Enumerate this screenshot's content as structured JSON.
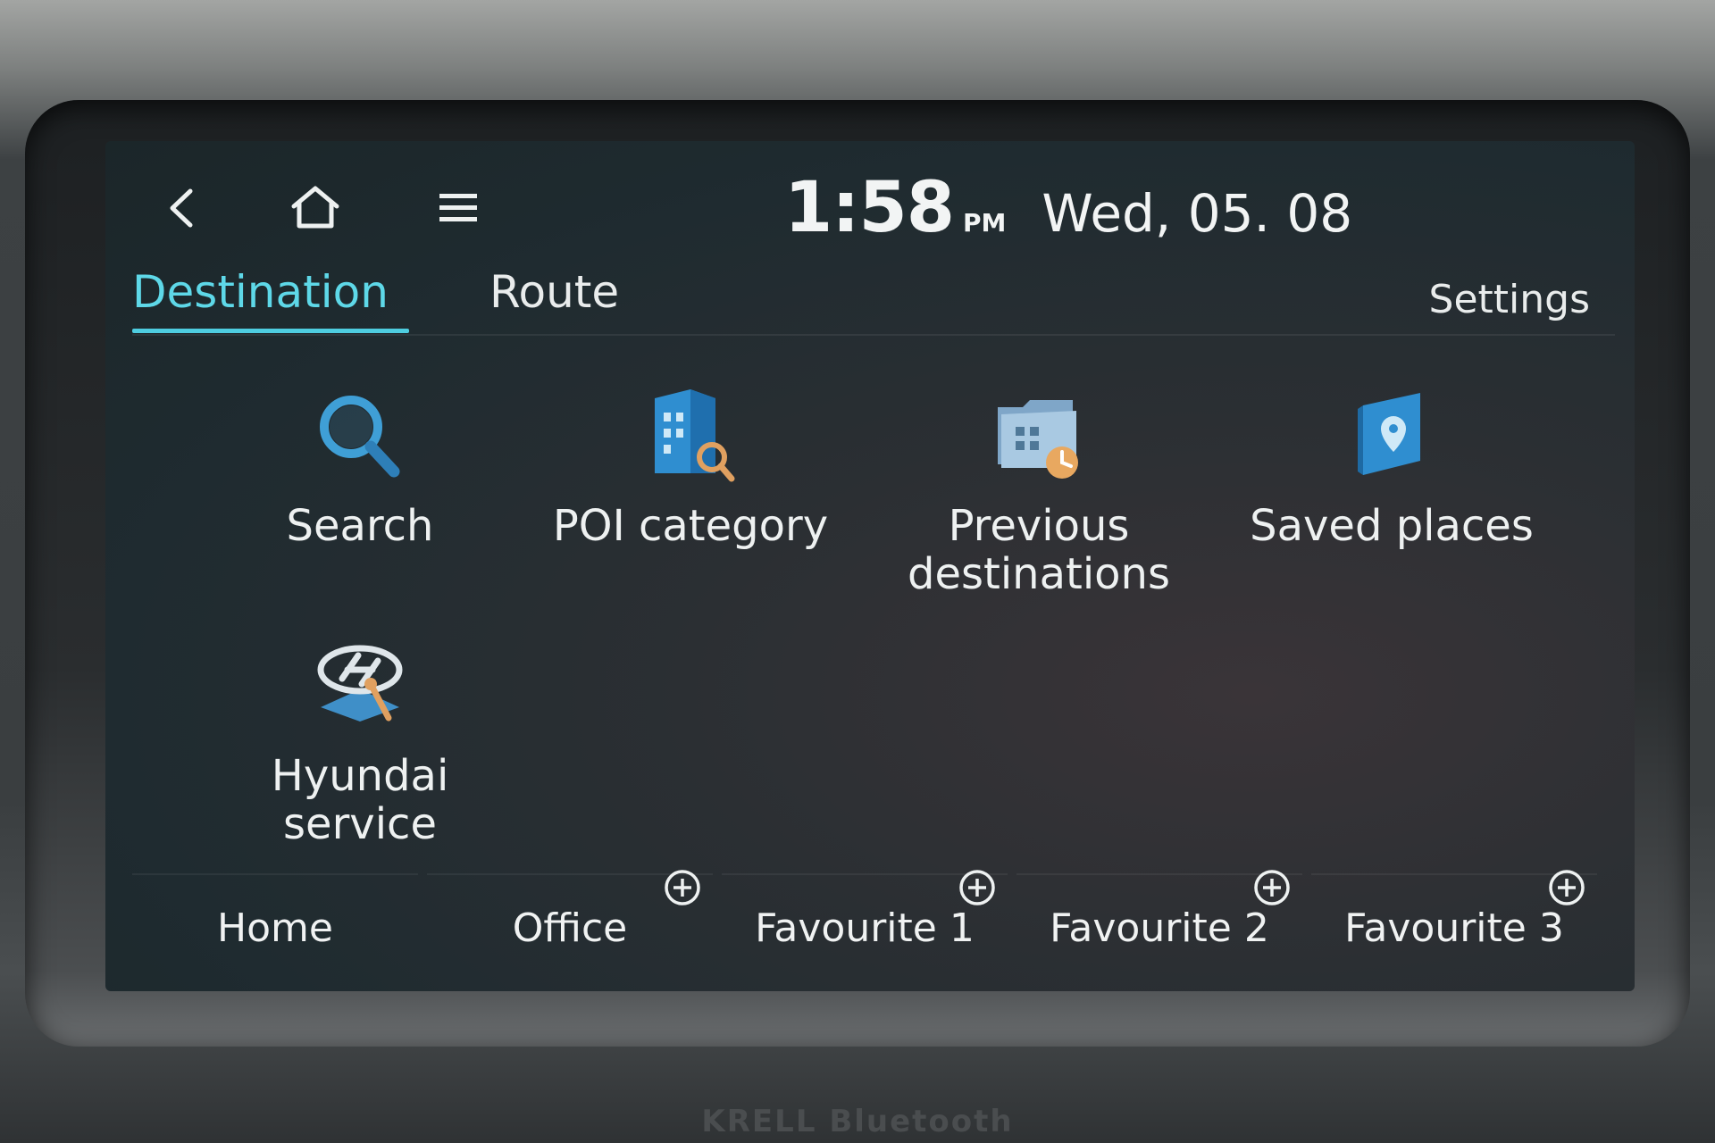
{
  "status": {
    "time": "1:58",
    "ampm": "PM",
    "date": "Wed, 05. 08"
  },
  "topbar": {
    "back_icon": "chevron-left-icon",
    "home_icon": "home-icon",
    "menu_icon": "hamburger-menu-icon"
  },
  "tabs": [
    {
      "label": "Destination",
      "active": true
    },
    {
      "label": "Route",
      "active": false
    }
  ],
  "settings_label": "Settings",
  "grid": [
    {
      "label_line1": "Search",
      "label_line2": "",
      "icon": "magnifier-icon"
    },
    {
      "label_line1": "POI category",
      "label_line2": "",
      "icon": "building-search-icon"
    },
    {
      "label_line1": "Previous",
      "label_line2": "destinations",
      "icon": "folder-clock-icon"
    },
    {
      "label_line1": "Saved places",
      "label_line2": "",
      "icon": "book-pin-icon"
    },
    {
      "label_line1": "Hyundai",
      "label_line2": "service",
      "icon": "hyundai-service-icon"
    }
  ],
  "favourites": [
    {
      "label": "Home",
      "add": false
    },
    {
      "label": "Office",
      "add": true
    },
    {
      "label": "Favourite 1",
      "add": true
    },
    {
      "label": "Favourite 2",
      "add": true
    },
    {
      "label": "Favourite 3",
      "add": true
    }
  ],
  "brand": "KRELL  Bluetooth",
  "colors": {
    "accent": "#5ed8e8",
    "text": "#eef1f1",
    "screen_bg": "#1f2b30"
  }
}
